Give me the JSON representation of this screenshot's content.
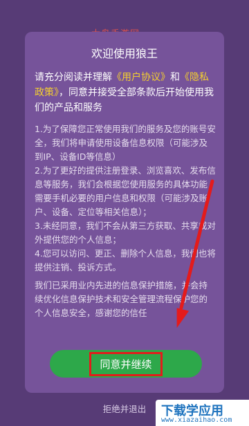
{
  "watermark_top": "大鸟手游网",
  "dialog": {
    "title": "欢迎使用狼王",
    "intro": {
      "before": "请充分阅读并理解",
      "link_user_agreement": "《用户协议》",
      "and": "和",
      "link_privacy": "《隐私政策》",
      "after": "，同意并接受全部条款后开始使用我们的产品和服务"
    },
    "terms": [
      "1.为了保障您正常使用我们的服务及您的账号安全，我们将申请使用设备信息权限（可能涉及到IP、设备ID等信息）",
      "2.为了更好的提供注册登录、浏览喜欢、发布信息等服务，我们会根据您使用服务的具体功能需要手机必要的用户信息和权限（可能涉及账户、设备、定位等相关信息）；",
      "3.未经同意，我们不会从第三方获取、共享或对外提供您的个人信息；",
      "4.您可以访问、更正、删除个人信息，我们也将提供注销、投诉方式。"
    ],
    "footer": "我们已采用业内先进的信息保护措施，并会持续优化信息保护技术和安全管理流程保护您的个人信息安全，感谢您的信任",
    "agree_button": "同意并继续",
    "reject_link": "拒绝并退出"
  },
  "badge": {
    "title": "下载学应用",
    "url": "www.xiazaihao.com"
  },
  "colors": {
    "background": "#573b76",
    "dialog": "#76539a",
    "link": "#f4cf2f",
    "button": "#2da84a",
    "highlight": "#e41b1b"
  }
}
